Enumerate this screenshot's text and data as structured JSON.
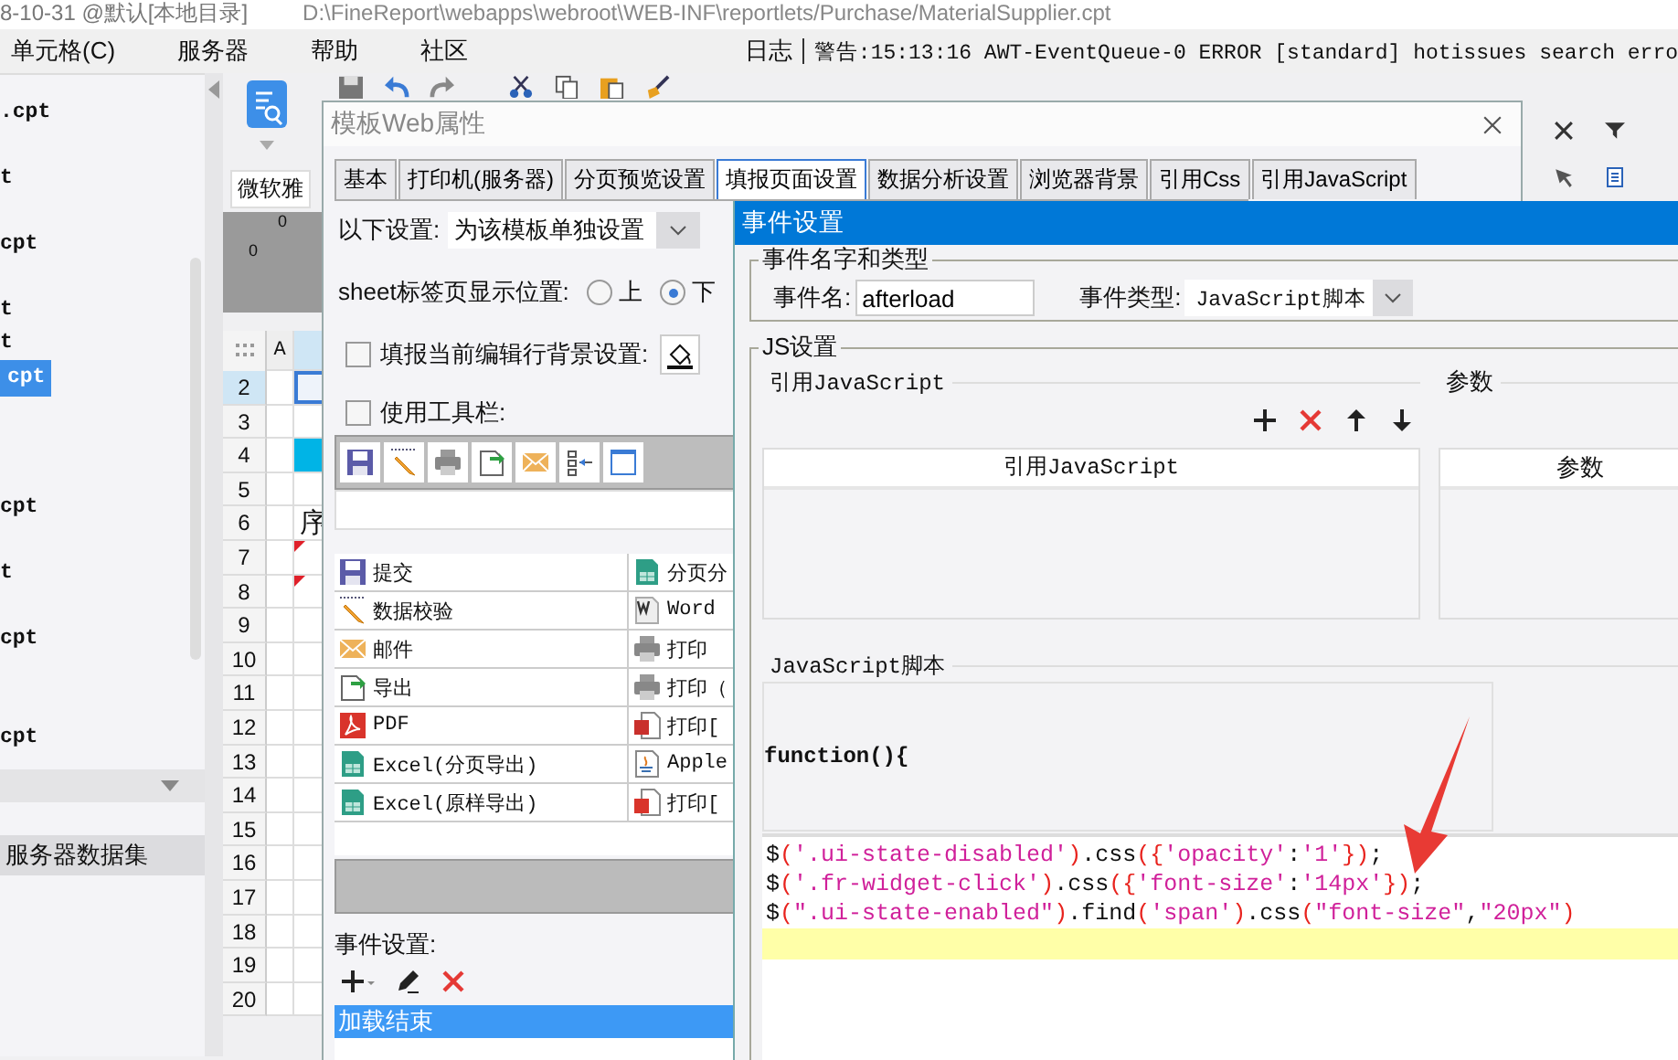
{
  "app_title": {
    "session": "8-10-31 @默认[本地目录]",
    "path": "D:\\FineReport\\webapps\\webroot\\WEB-INF\\reportlets/Purchase/MaterialSupplier.cpt"
  },
  "menu": [
    {
      "label": "单元格(C)"
    },
    {
      "label": "服务器"
    },
    {
      "label": "帮助"
    },
    {
      "label": "社区"
    }
  ],
  "log_tab": "日志",
  "log_message": "警告:15:13:16 AWT-EventQueue-0 ERROR [standard] hotissues search erro",
  "file_tree": [
    {
      "label": ".cpt",
      "selected": false
    },
    {
      "label": "t",
      "selected": false
    },
    {
      "label": "cpt",
      "selected": false
    },
    {
      "label": "t",
      "selected": false
    },
    {
      "label": "t",
      "selected": false
    },
    {
      "label": "cpt",
      "selected": true
    },
    {
      "label": "cpt",
      "selected": false
    },
    {
      "label": "t",
      "selected": false
    },
    {
      "label": "cpt",
      "selected": false
    },
    {
      "label": "cpt",
      "selected": false
    }
  ],
  "datasets_panel": "服务器数据集",
  "font_select": "微软雅",
  "ruler_labels": [
    "0",
    "0"
  ],
  "sheet": {
    "columns": [
      "A"
    ],
    "rows": [
      {
        "label": "2",
        "selected": true,
        "flagged": false
      },
      {
        "label": "3",
        "selected": false,
        "flagged": false
      },
      {
        "label": "4",
        "selected": false,
        "flagged": false,
        "color": "#00b4e6"
      },
      {
        "label": "5",
        "selected": false,
        "flagged": false
      },
      {
        "label": "6",
        "selected": false,
        "flagged": false,
        "text": "序"
      },
      {
        "label": "7",
        "selected": false,
        "flagged": true
      },
      {
        "label": "8",
        "selected": false,
        "flagged": true
      },
      {
        "label": "9",
        "selected": false,
        "flagged": false
      },
      {
        "label": "10",
        "selected": false,
        "flagged": false
      },
      {
        "label": "11",
        "selected": false,
        "flagged": false
      },
      {
        "label": "12",
        "selected": false,
        "flagged": false
      },
      {
        "label": "13",
        "selected": false,
        "flagged": false
      },
      {
        "label": "14",
        "selected": false,
        "flagged": false
      },
      {
        "label": "15",
        "selected": false,
        "flagged": false
      },
      {
        "label": "16",
        "selected": false,
        "flagged": false
      },
      {
        "label": "17",
        "selected": false,
        "flagged": false
      },
      {
        "label": "18",
        "selected": false,
        "flagged": false
      },
      {
        "label": "19",
        "selected": false,
        "flagged": false
      },
      {
        "label": "20",
        "selected": false,
        "flagged": false
      }
    ]
  },
  "web_dialog": {
    "title": "模板Web属性",
    "tabs": [
      {
        "label": "基本",
        "selected": false
      },
      {
        "label": "打印机(服务器)",
        "selected": false
      },
      {
        "label": "分页预览设置",
        "selected": false
      },
      {
        "label": "填报页面设置",
        "selected": true
      },
      {
        "label": "数据分析设置",
        "selected": false
      },
      {
        "label": "浏览器背景",
        "selected": false
      },
      {
        "label": "引用Css",
        "selected": false
      },
      {
        "label": "引用JavaScript",
        "selected": false
      }
    ],
    "scope_label": "以下设置:",
    "scope_value": "为该模板单独设置",
    "sheet_position": {
      "label": "sheet标签页显示位置:",
      "options": [
        {
          "label": "上",
          "selected": false
        },
        {
          "label": "下",
          "selected": true
        }
      ]
    },
    "row_background": {
      "label": "填报当前编辑行背景设置:",
      "checked": false
    },
    "use_toolbar": {
      "label": "使用工具栏:",
      "checked": false
    },
    "toolbar_icons": [
      {
        "kind": "save"
      },
      {
        "kind": "pencil"
      },
      {
        "kind": "print"
      },
      {
        "kind": "export"
      },
      {
        "kind": "mail"
      },
      {
        "kind": "columns"
      },
      {
        "kind": "window"
      }
    ],
    "buttons": [
      [
        {
          "label": "提交",
          "kind": "save"
        },
        {
          "label": "分页分",
          "kind": "excel"
        }
      ],
      [
        {
          "label": "数据校验",
          "kind": "pencil"
        },
        {
          "label": "Word",
          "kind": "word"
        }
      ],
      [
        {
          "label": "邮件",
          "kind": "mail"
        },
        {
          "label": "打印",
          "kind": "print"
        }
      ],
      [
        {
          "label": "导出",
          "kind": "export"
        },
        {
          "label": "打印（",
          "kind": "print"
        }
      ],
      [
        {
          "label": "PDF",
          "kind": "pdf"
        },
        {
          "label": "打印[",
          "kind": "flash"
        }
      ],
      [
        {
          "label": "Excel(分页导出)",
          "kind": "excel"
        },
        {
          "label": "Apple",
          "kind": "applet"
        }
      ],
      [
        {
          "label": "Excel(原样导出)",
          "kind": "excel"
        },
        {
          "label": "打印[",
          "kind": "pdfdoc"
        }
      ]
    ],
    "event_label": "事件设置:",
    "events": [
      {
        "label": "加载结束",
        "selected": true
      }
    ]
  },
  "event_dialog": {
    "title": "事件设置",
    "name_group": "事件名字和类型",
    "name_label": "事件名:",
    "name_value": "afterload",
    "type_label": "事件类型:",
    "type_value": "JavaScript脚本",
    "js_group": "JS设置",
    "ref_section": "引用JavaScript",
    "param_section": "参数",
    "ref_table": {
      "columns": [
        "引用JavaScript"
      ]
    },
    "param_table": {
      "columns": [
        "参数"
      ]
    },
    "script_section": "JavaScript脚本",
    "function_header": "function(){",
    "code_lines": [
      {
        "current": false,
        "tokens": [
          {
            "text": "$",
            "kind": "plain"
          },
          {
            "text": "(",
            "kind": "bracket"
          },
          {
            "text": "'.ui-state-disabled'",
            "kind": "string"
          },
          {
            "text": ")",
            "kind": "bracket"
          },
          {
            "text": ".css",
            "kind": "plain"
          },
          {
            "text": "({",
            "kind": "bracket"
          },
          {
            "text": "'opacity'",
            "kind": "string"
          },
          {
            "text": ":",
            "kind": "plain"
          },
          {
            "text": "'1'",
            "kind": "string"
          },
          {
            "text": "})",
            "kind": "bracket"
          },
          {
            "text": ";",
            "kind": "plain"
          }
        ]
      },
      {
        "current": false,
        "tokens": [
          {
            "text": "$",
            "kind": "plain"
          },
          {
            "text": "(",
            "kind": "bracket"
          },
          {
            "text": "'.fr-widget-click'",
            "kind": "string"
          },
          {
            "text": ")",
            "kind": "bracket"
          },
          {
            "text": ".css",
            "kind": "plain"
          },
          {
            "text": "({",
            "kind": "bracket"
          },
          {
            "text": "'font-size'",
            "kind": "string"
          },
          {
            "text": ":",
            "kind": "plain"
          },
          {
            "text": "'14px'",
            "kind": "string"
          },
          {
            "text": "})",
            "kind": "bracket"
          },
          {
            "text": ";",
            "kind": "plain"
          }
        ]
      },
      {
        "current": false,
        "tokens": [
          {
            "text": "$",
            "kind": "plain"
          },
          {
            "text": "(",
            "kind": "bracket"
          },
          {
            "text": "\".ui-state-enabled\"",
            "kind": "string"
          },
          {
            "text": ")",
            "kind": "bracket"
          },
          {
            "text": ".find",
            "kind": "plain"
          },
          {
            "text": "(",
            "kind": "bracket"
          },
          {
            "text": "'span'",
            "kind": "string"
          },
          {
            "text": ")",
            "kind": "bracket"
          },
          {
            "text": ".css",
            "kind": "plain"
          },
          {
            "text": "(",
            "kind": "bracket"
          },
          {
            "text": "\"font-size\"",
            "kind": "string"
          },
          {
            "text": ",",
            "kind": "plain"
          },
          {
            "text": "\"20px\"",
            "kind": "string"
          },
          {
            "text": ")",
            "kind": "bracket"
          }
        ]
      },
      {
        "current": true
      }
    ]
  }
}
